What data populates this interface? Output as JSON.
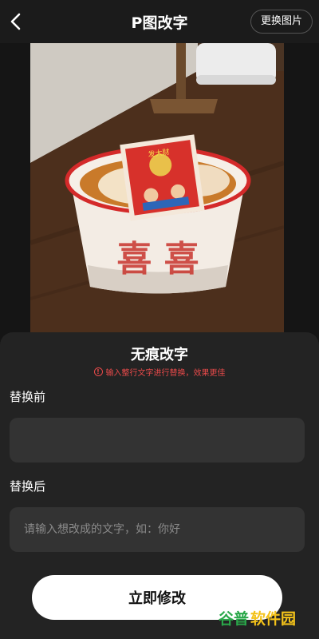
{
  "header": {
    "back_icon": "chevron-left-icon",
    "title": "P图改字",
    "change_image_label": "更换图片"
  },
  "photo": {
    "description_icon": "photo-image",
    "card_label": "发大财"
  },
  "panel": {
    "title": "无痕改字",
    "hint_icon": "info-circle-icon",
    "hint": "输入整行文字进行替换，效果更佳",
    "before_label": "替换前",
    "before_value": "",
    "after_label": "替换后",
    "after_placeholder": "请输入想改成的文字，如：你好",
    "after_value": "",
    "submit_label": "立即修改"
  },
  "watermark": {
    "part1": "谷普",
    "part2": "软件园"
  },
  "colors": {
    "background": "#151515",
    "panel": "#232323",
    "field": "#333333",
    "hint": "#e84a4a",
    "button": "#ffffff"
  }
}
